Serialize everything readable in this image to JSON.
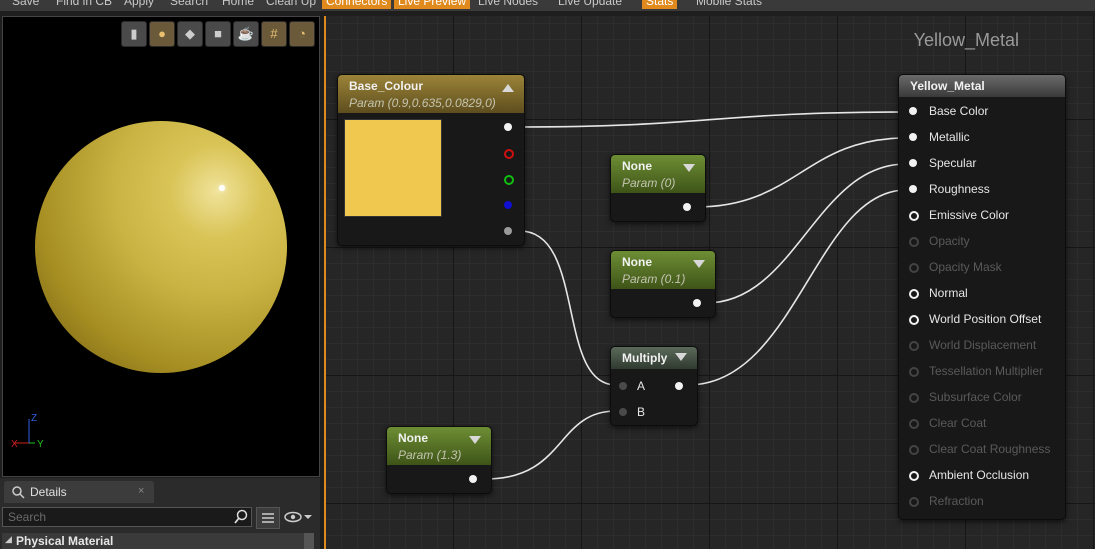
{
  "toolbar": {
    "items": [
      {
        "label": "Save"
      },
      {
        "label": "Find in CB"
      },
      {
        "label": "Apply"
      },
      {
        "label": "Search"
      },
      {
        "label": "Home"
      },
      {
        "label": "Clean Up"
      },
      {
        "label": "Connectors",
        "active": true
      },
      {
        "label": "Live Preview",
        "active": true
      },
      {
        "label": "Live Nodes"
      },
      {
        "label": "Live Update"
      },
      {
        "label": "Stats",
        "active": true
      },
      {
        "label": "Mobile Stats"
      }
    ]
  },
  "viewport": {
    "tools": [
      "cylinder-icon",
      "sphere-icon",
      "plane-icon",
      "cube-icon",
      "teapot-icon",
      "grid-icon",
      "realtime-icon"
    ],
    "axis": {
      "x": "X",
      "y": "Y",
      "z": "Z"
    }
  },
  "details": {
    "tab_label": "Details",
    "close_glyph": "×",
    "search_placeholder": "Search",
    "category": "Physical Material"
  },
  "graph": {
    "title": "Yellow_Metal",
    "nodes": {
      "base_colour": {
        "title": "Base_Colour",
        "sub": "Param (0.9,0.635,0.0829,0)",
        "swatch": "#f0c850"
      },
      "metal_param": {
        "title": "None",
        "sub": "Param (0)"
      },
      "spec_param": {
        "title": "None",
        "sub": "Param (0.1)"
      },
      "multiply": {
        "title": "Multiply",
        "input_a": "A",
        "input_b": "B"
      },
      "rough_param": {
        "title": "None",
        "sub": "Param (1.3)"
      },
      "result": {
        "title": "Yellow_Metal",
        "inputs": [
          {
            "label": "Base Color",
            "state": "connected"
          },
          {
            "label": "Metallic",
            "state": "connected"
          },
          {
            "label": "Specular",
            "state": "connected"
          },
          {
            "label": "Roughness",
            "state": "connected"
          },
          {
            "label": "Emissive Color",
            "state": "open"
          },
          {
            "label": "Opacity",
            "state": "disabled"
          },
          {
            "label": "Opacity Mask",
            "state": "disabled"
          },
          {
            "label": "Normal",
            "state": "open"
          },
          {
            "label": "World Position Offset",
            "state": "open"
          },
          {
            "label": "World Displacement",
            "state": "disabled"
          },
          {
            "label": "Tessellation Multiplier",
            "state": "disabled"
          },
          {
            "label": "Subsurface Color",
            "state": "disabled"
          },
          {
            "label": "Clear Coat",
            "state": "disabled"
          },
          {
            "label": "Clear Coat Roughness",
            "state": "disabled"
          },
          {
            "label": "Ambient Occlusion",
            "state": "open"
          },
          {
            "label": "Refraction",
            "state": "disabled"
          }
        ]
      }
    }
  },
  "colors": {
    "accent": "#e08a1e",
    "param_header": "#5c7a2a",
    "vector_param_header": "#8a7330",
    "pin_red": "#d01010",
    "pin_green": "#10c010",
    "pin_blue": "#1010d0"
  }
}
